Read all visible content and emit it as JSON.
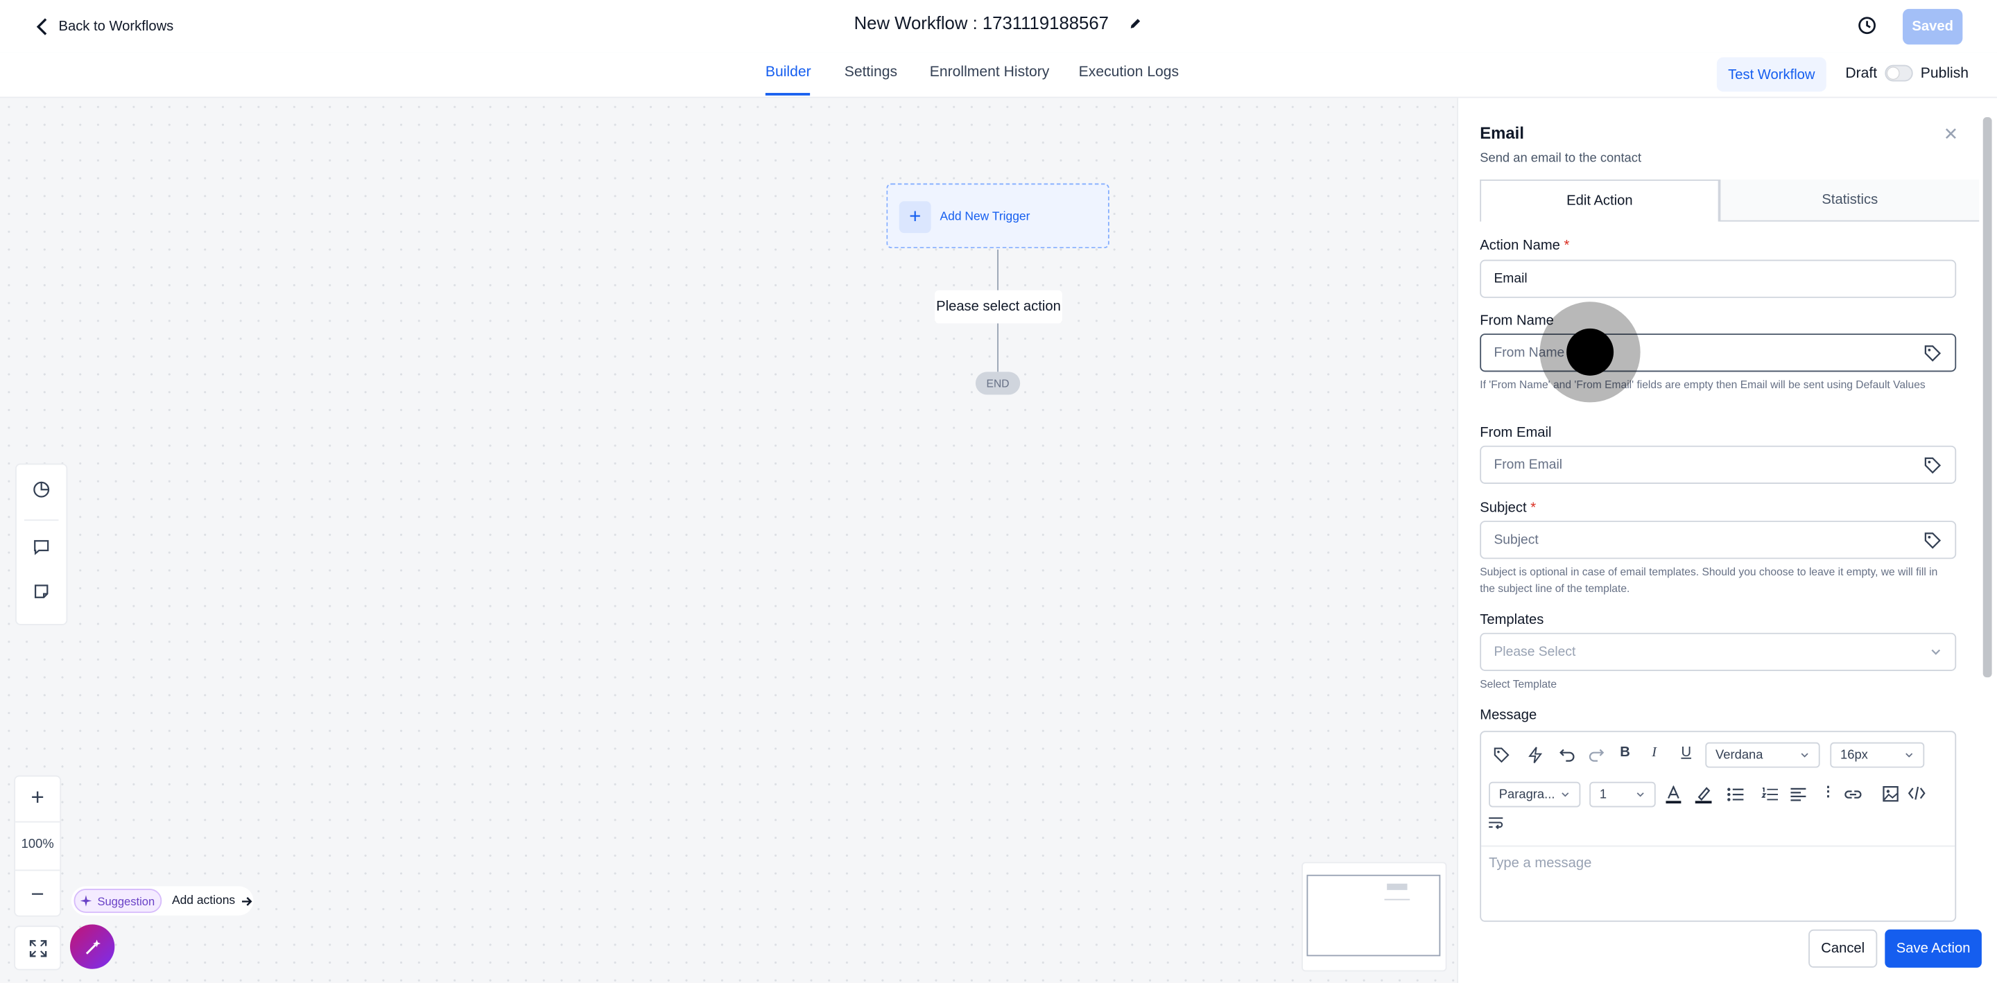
{
  "header": {
    "back_label": "Back to Workflows",
    "workflow_title": "New Workflow : 1731119188567",
    "saved_label": "Saved"
  },
  "tabs": [
    {
      "label": "Builder",
      "active": true
    },
    {
      "label": "Settings",
      "active": false
    },
    {
      "label": "Enrollment History",
      "active": false
    },
    {
      "label": "Execution Logs",
      "active": false
    }
  ],
  "actions": {
    "test_workflow_label": "Test Workflow",
    "draft_label": "Draft",
    "publish_label": "Publish",
    "publish_toggle_on": false
  },
  "canvas": {
    "trigger_label": "Add New Trigger",
    "select_action_label": "Please select action",
    "end_label": "END",
    "zoom_level": "100%",
    "suggestion_label": "Suggestion",
    "add_actions_label": "Add actions"
  },
  "panel": {
    "title": "Email",
    "subtitle": "Send an email to the contact",
    "tab_edit": "Edit Action",
    "tab_stats": "Statistics",
    "action_name_label": "Action Name",
    "action_name_value": "Email",
    "from_name_label": "From Name",
    "from_name_placeholder": "From Name",
    "from_name_help": "If 'From Name' and 'From Email' fields are empty then Email will be sent using Default Values",
    "from_email_label": "From Email",
    "from_email_placeholder": "From Email",
    "subject_label": "Subject",
    "subject_placeholder": "Subject",
    "subject_help": "Subject is optional in case of email templates. Should you choose to leave it empty, we will fill in the subject line of the template.",
    "templates_label": "Templates",
    "templates_placeholder": "Please Select",
    "templates_help": "Select Template",
    "message_label": "Message",
    "font_family": "Verdana",
    "font_size": "16px",
    "block_type": "Paragra...",
    "line_height": "1",
    "message_placeholder": "Type a message",
    "cancel_label": "Cancel",
    "save_label": "Save Action",
    "required_mark": "*"
  },
  "colors": {
    "accent": "#155eef",
    "saved_bg": "#a3bff7",
    "suggestion": "#6941c6"
  }
}
